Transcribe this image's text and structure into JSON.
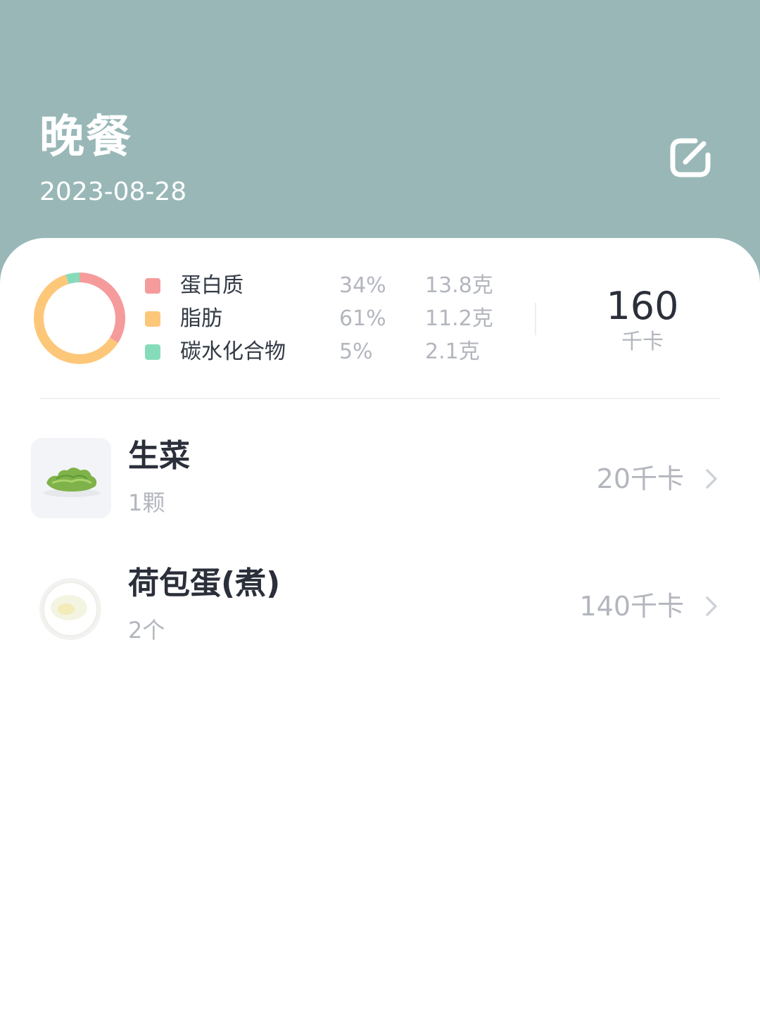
{
  "header": {
    "title": "晚餐",
    "date": "2023-08-28",
    "edit_icon": "edit-icon",
    "background_color": "#99b7b7"
  },
  "nutrition": {
    "total_calories": "160",
    "total_unit": "千卡",
    "items": [
      {
        "name": "蛋白质",
        "percent": "34%",
        "amount": "13.8克",
        "share": 0.34,
        "color": "#f59b9b"
      },
      {
        "name": "脂肪",
        "percent": "61%",
        "amount": "11.2克",
        "share": 0.61,
        "color": "#fdc77a"
      },
      {
        "name": "碳水化合物",
        "percent": "5%",
        "amount": "2.1克",
        "share": 0.05,
        "color": "#86dcba"
      }
    ]
  },
  "foods": [
    {
      "name": "生菜",
      "quantity": "1颗",
      "calories": "20千卡",
      "thumb_icon": "lettuce-icon",
      "chevron_icon": "chevron-right-icon"
    },
    {
      "name": "荷包蛋(煮)",
      "quantity": "2个",
      "calories": "140千卡",
      "thumb_icon": "boiled-egg-icon",
      "chevron_icon": "chevron-right-icon"
    }
  ]
}
